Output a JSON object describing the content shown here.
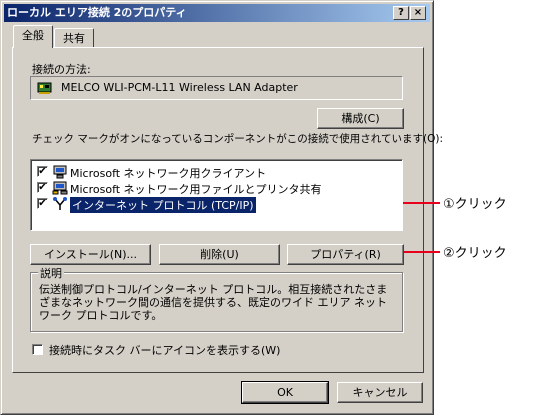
{
  "window": {
    "title": "ローカル エリア接続 2のプロパティ",
    "help_btn": "?",
    "close_btn": "×"
  },
  "tabs": [
    {
      "label": "全般",
      "active": true
    },
    {
      "label": "共有",
      "active": false
    }
  ],
  "connect_using": {
    "label": "接続の方法:",
    "adapter": "MELCO WLI-PCM-L11 Wireless LAN Adapter",
    "icon": "network-card-icon",
    "configure_btn": "構成(C)"
  },
  "components": {
    "label": "チェック マークがオンになっているコンポーネントがこの接続で使用されています(O):",
    "items": [
      {
        "label": "Microsoft ネットワーク用クライアント",
        "checked": true,
        "icon": "network-client-icon",
        "selected": false
      },
      {
        "label": "Microsoft ネットワーク用ファイルとプリンタ共有",
        "checked": true,
        "icon": "file-printer-share-icon",
        "selected": false
      },
      {
        "label": "インターネット プロトコル (TCP/IP)",
        "checked": true,
        "icon": "protocol-icon",
        "selected": true
      }
    ],
    "check_mark": "✔"
  },
  "buttons": {
    "install": "インストール(N)...",
    "uninstall": "削除(U)",
    "properties": "プロパティ(R)"
  },
  "description": {
    "title": "説明",
    "text": "伝送制御プロトコル/インターネット プロトコル。相互接続されたさまざまなネットワーク間の通信を提供する、既定のワイド エリア ネットワーク プロトコルです。"
  },
  "taskbar_option": {
    "label": "接続時にタスク バーにアイコンを表示する(W)",
    "checked": false
  },
  "footer": {
    "ok": "OK",
    "cancel": "キャンセル"
  },
  "annotations": {
    "step1": "①クリック",
    "step2": "②クリック",
    "color": "#e8001c"
  }
}
